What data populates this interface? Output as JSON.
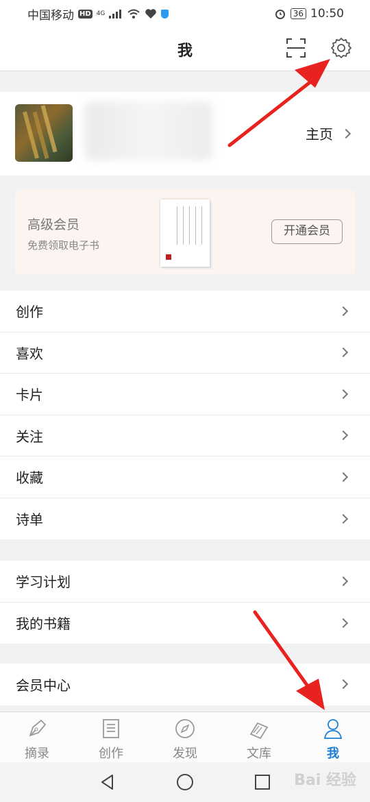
{
  "status": {
    "carrier": "中国移动",
    "hd": "HD",
    "network": "4G",
    "battery": "36",
    "time": "10:50"
  },
  "header": {
    "title": "我"
  },
  "profile": {
    "homepage_label": "主页"
  },
  "vip": {
    "title": "高级会员",
    "subtitle": "免费领取电子书",
    "button": "开通会员"
  },
  "group1": [
    "创作",
    "喜欢",
    "卡片",
    "关注",
    "收藏",
    "诗单"
  ],
  "group2": [
    "学习计划",
    "我的书籍"
  ],
  "group3": [
    "会员中心"
  ],
  "tabs": [
    "摘录",
    "创作",
    "发现",
    "文库",
    "我"
  ],
  "colors": {
    "accent": "#1a7fd4",
    "arrow": "#e8231f"
  },
  "watermark": "Bai 经验"
}
